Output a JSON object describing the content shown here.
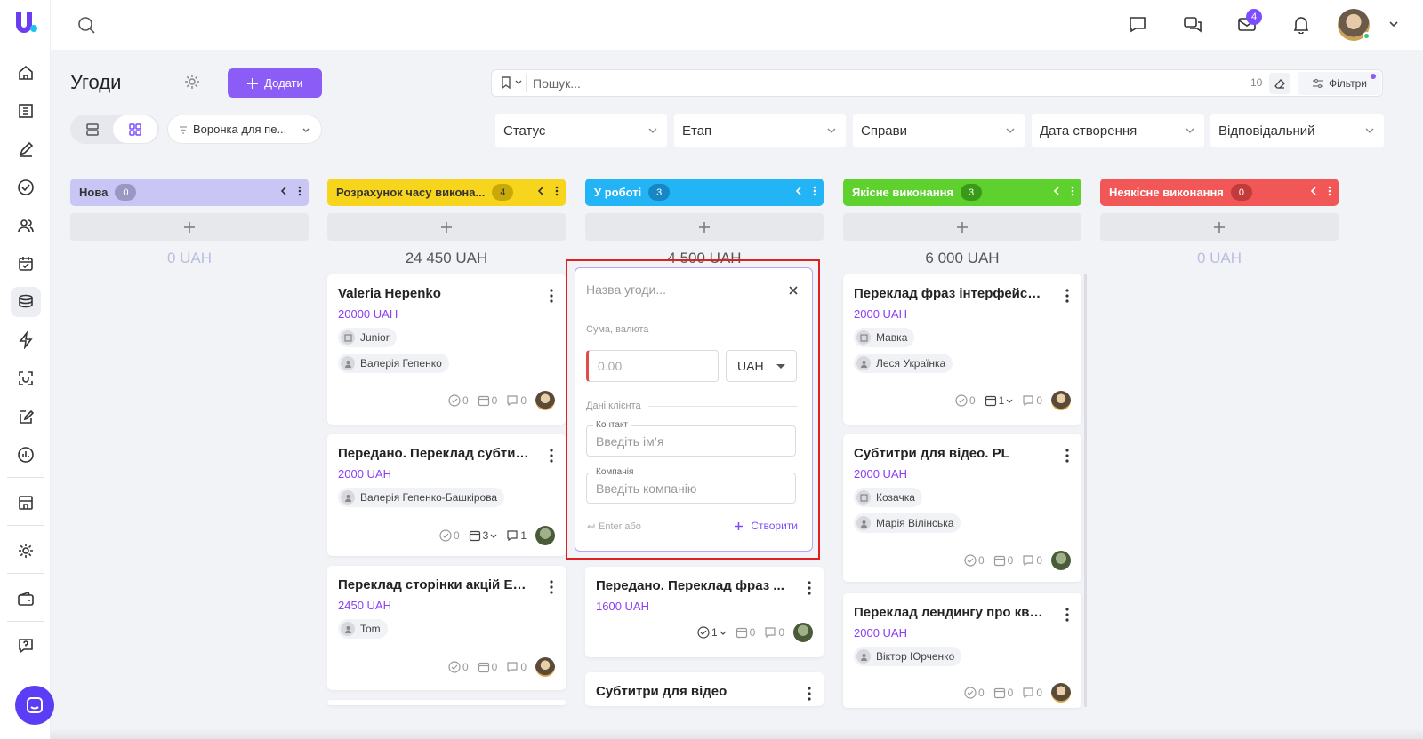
{
  "sidebar": {
    "items": [
      {
        "name": "home-icon"
      },
      {
        "name": "building-icon"
      },
      {
        "name": "edit-icon"
      },
      {
        "name": "check-circle-icon"
      },
      {
        "name": "users-icon"
      },
      {
        "name": "calendar-icon"
      },
      {
        "name": "deals-stack-icon",
        "active": true
      },
      {
        "name": "lightning-icon"
      },
      {
        "name": "scan-icon"
      },
      {
        "name": "document-edit-icon"
      },
      {
        "name": "analytics-icon"
      },
      {
        "name": "store-icon"
      },
      {
        "name": "gear-icon"
      },
      {
        "name": "wallet-icon"
      },
      {
        "name": "help-icon"
      }
    ]
  },
  "topbar": {
    "mail_badge": "4"
  },
  "page": {
    "title": "Угоди",
    "add_label": "Додати",
    "funnel_label": "Воронка для пе...",
    "search_placeholder": "Пошук...",
    "search_count": "10",
    "filters_label": "Фільтри"
  },
  "filters": [
    "Статус",
    "Етап",
    "Справи",
    "Дата створення",
    "Відповідальний"
  ],
  "columns": [
    {
      "title": "Нова",
      "count": "0",
      "sum": "0 UAH",
      "color": "#c9c6f5",
      "text": "#333",
      "count_bg": "#9a97c4",
      "count_text": "#fff"
    },
    {
      "title": "Розрахунок часу викона...",
      "count": "4",
      "sum": "24 450 UAH",
      "color": "#f7d51d",
      "text": "#333",
      "count_bg": "#c9a90a",
      "count_text": "#333"
    },
    {
      "title": "У роботі",
      "count": "3",
      "sum": "4 500 UAH",
      "color": "#22b4f5",
      "text": "#fff",
      "count_bg": "#1686c4",
      "count_text": "#fff"
    },
    {
      "title": "Якісне виконання",
      "count": "3",
      "sum": "6 000 UAH",
      "color": "#5ed12e",
      "text": "#fff",
      "count_bg": "#3a9a18",
      "count_text": "#fff"
    },
    {
      "title": "Неякісне виконання",
      "count": "0",
      "sum": "0 UAH",
      "color": "#f25757",
      "text": "#fff",
      "count_bg": "#c23a3a",
      "count_text": "#fff"
    }
  ],
  "cards": {
    "col2": [
      {
        "title": "Valeria Hepenko",
        "amount": "20000 UAH",
        "chips": [
          "Junior",
          "Валерія Гепенко"
        ],
        "tasks": "0",
        "events": "0",
        "comments": "0"
      },
      {
        "title": "Передано. Переклад субтит...",
        "amount": "2000 UAH",
        "chips": [
          "Валерія Гепенко-Башкірова"
        ],
        "tasks": "0",
        "events": "3",
        "comments": "1"
      },
      {
        "title": "Переклад сторінки акцій ENG",
        "amount": "2450 UAH",
        "chips": [
          "Tom"
        ],
        "tasks": "0",
        "events": "0",
        "comments": "0"
      }
    ],
    "col3": [
      {
        "title": "Передано. Переклад фраз ...",
        "amount": "1600 UAH",
        "tasks": "1",
        "events": "0",
        "comments": "0"
      },
      {
        "title": "Субтитри для відео"
      }
    ],
    "col4": [
      {
        "title": "Переклад фраз інтерфейсу ...",
        "amount": "2000 UAH",
        "chips": [
          "Мавка",
          "Леся Українка"
        ],
        "tasks": "0",
        "events": "1",
        "comments": "0"
      },
      {
        "title": "Субтитри для відео. PL",
        "amount": "2000 UAH",
        "chips": [
          "Козачка",
          "Марія Вілінська"
        ],
        "tasks": "0",
        "events": "0",
        "comments": "0"
      },
      {
        "title": "Переклад лендингу про квіти",
        "amount": "2000 UAH",
        "chips": [
          "Віктор Юрченко"
        ],
        "tasks": "0",
        "events": "0",
        "comments": "0"
      }
    ]
  },
  "quick_form": {
    "name_placeholder": "Назва угоди...",
    "section_amount": "Сума, валюта",
    "amount_placeholder": "0.00",
    "currency": "UAH",
    "section_client": "Дані клієнта",
    "contact_label": "Контакт",
    "contact_placeholder": "Введіть ім’я",
    "company_label": "Компанія",
    "company_placeholder": "Введіть компанію",
    "hint": "Enter або",
    "create_label": "Створити"
  }
}
